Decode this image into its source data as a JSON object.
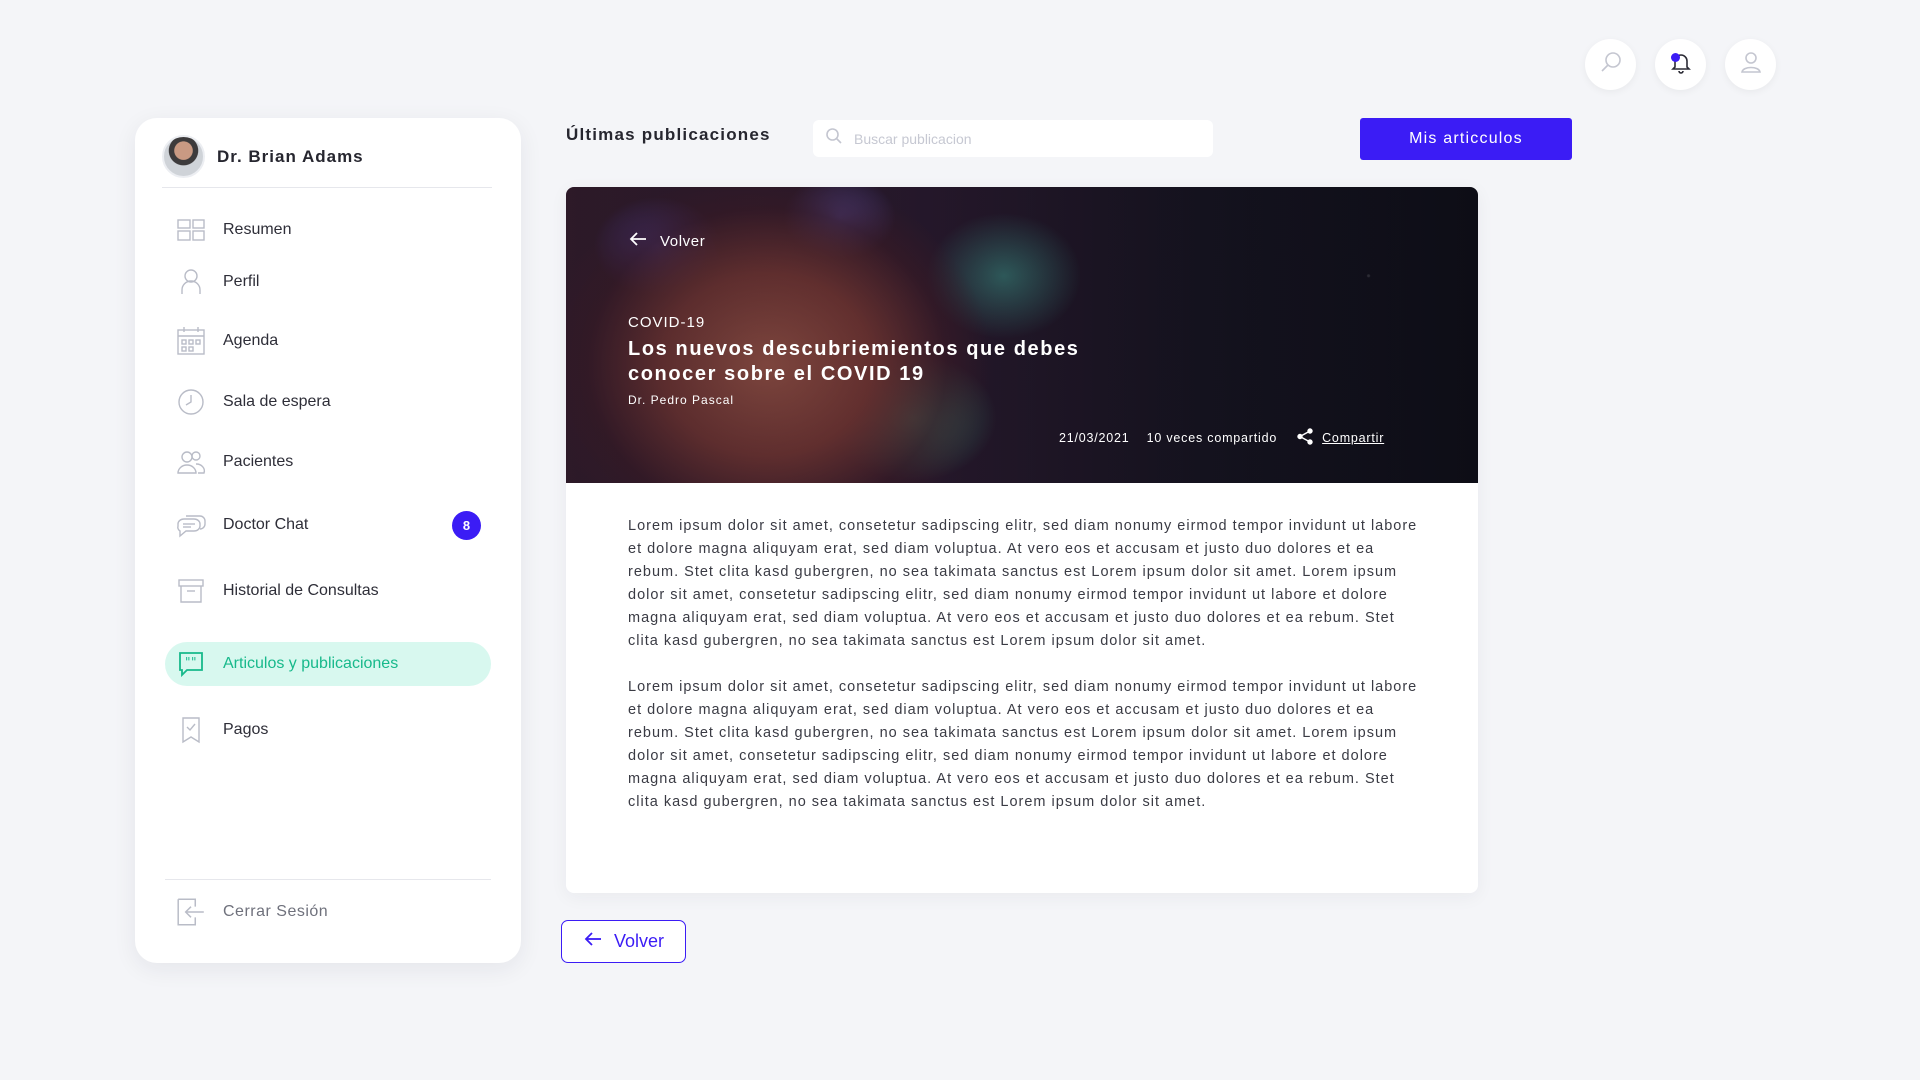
{
  "header": {
    "icons": [
      "search-icon",
      "bell-icon",
      "user-icon"
    ]
  },
  "sidebar": {
    "doctor_name": "Dr. Brian Adams",
    "items": [
      {
        "label": "Resumen",
        "icon": "dashboard-icon"
      },
      {
        "label": "Perfil",
        "icon": "person-icon"
      },
      {
        "label": "Agenda",
        "icon": "calendar-icon"
      },
      {
        "label": "Sala de espera",
        "icon": "clock-icon"
      },
      {
        "label": "Pacientes",
        "icon": "patients-icon"
      },
      {
        "label": "Doctor Chat",
        "icon": "chat-icon",
        "badge": "8"
      },
      {
        "label": "Historial de Consultas",
        "icon": "archive-icon"
      },
      {
        "label": "Articulos y publicaciones",
        "icon": "quote-icon",
        "active": true
      },
      {
        "label": "Pagos",
        "icon": "receipt-icon"
      }
    ],
    "logout_label": "Cerrar Sesión"
  },
  "main": {
    "title": "Últimas publicaciones",
    "search_placeholder": "Buscar publicacion",
    "my_articles_label": "Mis articculos"
  },
  "article": {
    "back_label": "Volver",
    "tag": "COVID-19",
    "title": "Los nuevos descubriemientos que debes conocer sobre el COVID 19",
    "author": "Dr. Pedro Pascal",
    "date": "21/03/2021",
    "shared_count": "10 veces compartido",
    "share_label": "Compartir",
    "paragraphs": [
      "Lorem ipsum dolor sit amet, consetetur sadipscing elitr, sed diam nonumy eirmod tempor invidunt ut labore et dolore magna aliquyam erat, sed diam voluptua. At vero eos et accusam et justo duo dolores et ea rebum. Stet clita kasd gubergren, no sea takimata sanctus est Lorem ipsum dolor sit amet. Lorem ipsum dolor sit amet, consetetur sadipscing elitr, sed diam nonumy eirmod tempor invidunt ut labore et dolore magna aliquyam erat, sed diam voluptua. At vero eos et accusam et justo duo dolores et ea rebum. Stet clita kasd gubergren, no sea takimata sanctus est Lorem ipsum dolor sit amet.",
      "Lorem ipsum dolor sit amet, consetetur sadipscing elitr, sed diam nonumy eirmod tempor invidunt ut labore et dolore magna aliquyam erat, sed diam voluptua. At vero eos et accusam et justo duo dolores et ea rebum. Stet clita kasd gubergren, no sea takimata sanctus est Lorem ipsum dolor sit amet. Lorem ipsum dolor sit amet, consetetur sadipscing elitr, sed diam nonumy eirmod tempor invidunt ut labore et dolore magna aliquyam erat, sed diam voluptua. At vero eos et accusam et justo duo dolores et ea rebum. Stet clita kasd gubergren, no sea takimata sanctus est Lorem ipsum dolor sit amet."
    ]
  },
  "footer": {
    "back_button_label": "Volver"
  },
  "colors": {
    "accent": "#3b1cf5",
    "active_green": "#17b98b",
    "active_bg": "#d8f8ef",
    "background": "#f4f5f8"
  }
}
